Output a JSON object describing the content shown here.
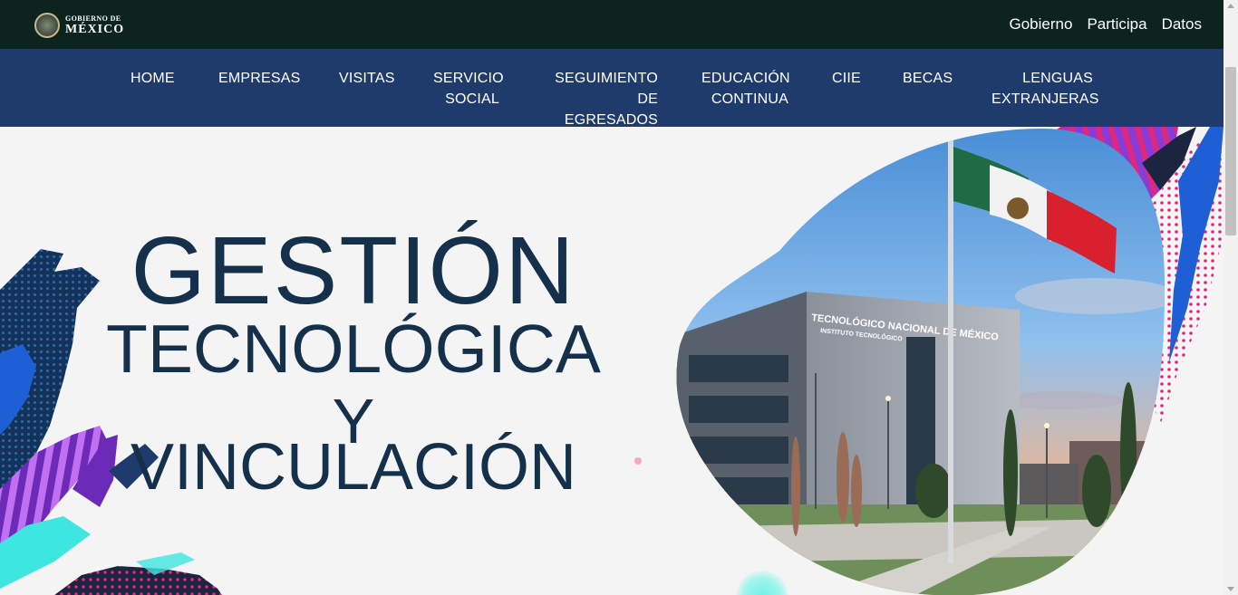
{
  "gov_bar": {
    "logo_small": "GOBIERNO DE",
    "logo_big": "MÉXICO",
    "links": [
      "Gobierno",
      "Participa",
      "Datos"
    ]
  },
  "nav": {
    "items": [
      {
        "line1": "HOME",
        "line2": ""
      },
      {
        "line1": "EMPRESAS",
        "line2": ""
      },
      {
        "line1": "VISITAS",
        "line2": ""
      },
      {
        "line1": "SERVICIO",
        "line2": "SOCIAL"
      },
      {
        "line1": "SEGUIMIENTO",
        "line2": "DE EGRESADOS"
      },
      {
        "line1": "EDUCACIÓN",
        "line2": "CONTINUA"
      },
      {
        "line1": "CIIE",
        "line2": ""
      },
      {
        "line1": "BECAS",
        "line2": ""
      },
      {
        "line1": "LENGUAS",
        "line2": "EXTRANJERAS"
      }
    ]
  },
  "hero": {
    "title_line1": "GESTIÓN",
    "title_line2": "TECNOLÓGICA",
    "title_line3": "Y",
    "title_line4": "VINCULACIÓN",
    "building_sign": "TECNOLÓGICO NACIONAL DE MÉXICO",
    "building_subsign": "INSTITUTO TECNOLÓGICO"
  },
  "colors": {
    "gov_bar": "#0c231e",
    "nav": "#1f3b6c",
    "title": "#14304a",
    "accent_magenta": "#e0287a",
    "accent_purple": "#8a3bd6",
    "accent_cyan": "#3ee6e0",
    "accent_blue": "#1f5fd6"
  }
}
